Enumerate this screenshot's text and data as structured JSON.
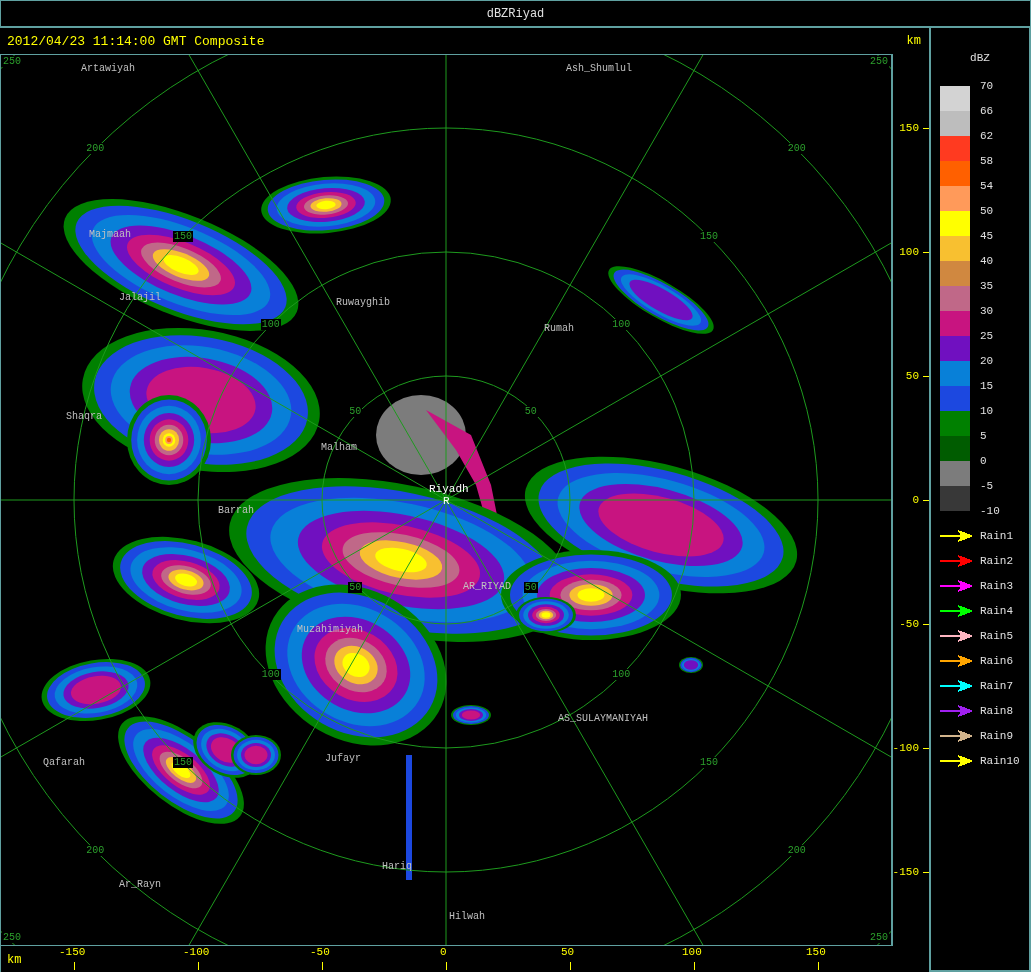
{
  "window": {
    "title": "dBZRiyad"
  },
  "header": {
    "timestamp": "2012/04/23 11:14:00 GMT Composite",
    "unit": "km"
  },
  "map": {
    "places": [
      {
        "name": "Artawiyah",
        "kind": "town"
      },
      {
        "name": "Ash_Shumlul",
        "kind": "town"
      },
      {
        "name": "Majmaah",
        "kind": "town"
      },
      {
        "name": "Jalajil",
        "kind": "town"
      },
      {
        "name": "Ruwayghib",
        "kind": "town"
      },
      {
        "name": "Rumah",
        "kind": "town"
      },
      {
        "name": "Shaqra",
        "kind": "town"
      },
      {
        "name": "Malham",
        "kind": "town"
      },
      {
        "name": "Riyadh",
        "kind": "radar_site"
      },
      {
        "name": "R",
        "kind": "radar_site"
      },
      {
        "name": "Barrah",
        "kind": "town"
      },
      {
        "name": "AR_RIYAD",
        "kind": "town"
      },
      {
        "name": "Muzahimiyah",
        "kind": "town"
      },
      {
        "name": "AS_SULAYMANIYAH",
        "kind": "town"
      },
      {
        "name": "Qafarah",
        "kind": "town"
      },
      {
        "name": "Jufayr",
        "kind": "town"
      },
      {
        "name": "Ar_Rayn",
        "kind": "town"
      },
      {
        "name": "Hariq",
        "kind": "town"
      },
      {
        "name": "Hilwah",
        "kind": "town"
      }
    ],
    "range_rings": [
      {
        "labels": [
          "50",
          "50",
          "50",
          "50"
        ]
      },
      {
        "labels": [
          "100",
          "100",
          "100",
          "100"
        ]
      },
      {
        "labels": [
          "150",
          "150",
          "150",
          "150"
        ]
      },
      {
        "labels": [
          "200",
          "200",
          "200",
          "200"
        ]
      },
      {
        "labels": [
          "250",
          "250",
          "250",
          "250"
        ]
      }
    ]
  },
  "y_axis": {
    "ticks": [
      "150",
      "100",
      "50",
      "0",
      "-50",
      "-100",
      "-150"
    ]
  },
  "x_axis": {
    "unit": "km",
    "ticks": [
      "-150",
      "-100",
      "-50",
      "0",
      "50",
      "100",
      "150"
    ]
  },
  "legend": {
    "title": "dBZ",
    "levels": [
      "70",
      "66",
      "62",
      "58",
      "54",
      "50",
      "45",
      "40",
      "35",
      "30",
      "25",
      "20",
      "15",
      "10",
      "5",
      "0",
      "-5",
      "-10"
    ],
    "bins": [
      {
        "color": "#d3d3d3"
      },
      {
        "color": "#bdbdbd"
      },
      {
        "color": "#ff3a20"
      },
      {
        "color": "#ff6000"
      },
      {
        "color": "#ff9a5a"
      },
      {
        "color": "#ffff00"
      },
      {
        "color": "#f8c030"
      },
      {
        "color": "#d08840"
      },
      {
        "color": "#c06888"
      },
      {
        "color": "#c81480"
      },
      {
        "color": "#7010c0"
      },
      {
        "color": "#0880d8"
      },
      {
        "color": "#1c48e0"
      },
      {
        "color": "#008000"
      },
      {
        "color": "#005c00"
      },
      {
        "color": "#7c7c7c"
      },
      {
        "color": "#383838"
      }
    ],
    "tracks": [
      {
        "label": "Rain1",
        "color": "#ffff00"
      },
      {
        "label": "Rain2",
        "color": "#ff0000"
      },
      {
        "label": "Rain3",
        "color": "#ff00ff"
      },
      {
        "label": "Rain4",
        "color": "#00ff00"
      },
      {
        "label": "Rain5",
        "color": "#ffb6c1"
      },
      {
        "label": "Rain6",
        "color": "#ffa500"
      },
      {
        "label": "Rain7",
        "color": "#00ffff"
      },
      {
        "label": "Rain8",
        "color": "#a020f0"
      },
      {
        "label": "Rain9",
        "color": "#d2b48c"
      },
      {
        "label": "Rain10",
        "color": "#ffff00"
      }
    ]
  }
}
